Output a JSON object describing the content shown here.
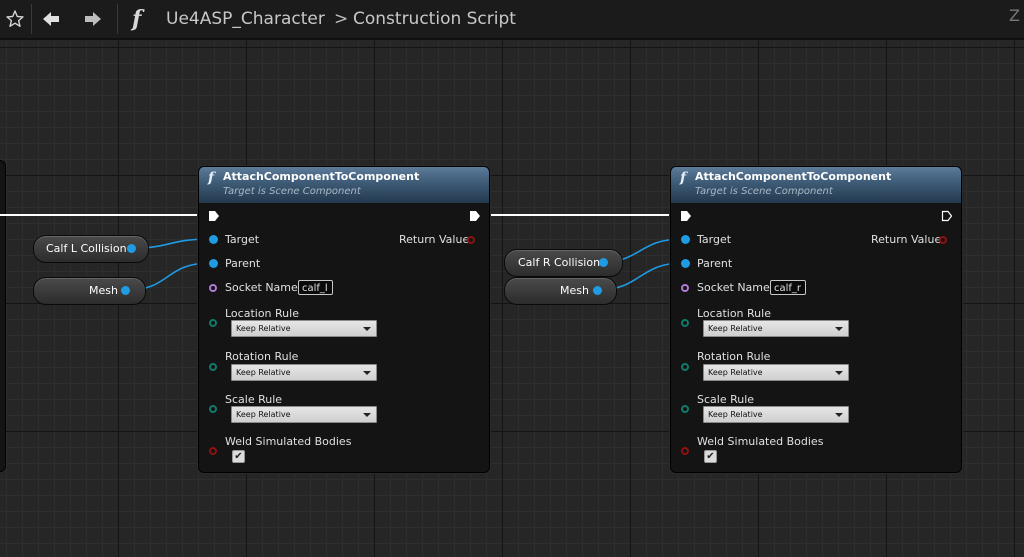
{
  "toolbar": {
    "function_glyph": "f",
    "breadcrumb_parent": "Ue4ASP_Character",
    "breadcrumb_separator": ">",
    "breadcrumb_current": "Construction Script",
    "right_edge_text": "Z"
  },
  "nodes": [
    {
      "title": "AttachComponentToComponent",
      "subtitle": "Target is Scene Component",
      "target_label": "Target",
      "parent_label": "Parent",
      "socket_label": "Socket Name",
      "socket_value": "calf_l",
      "return_label": "Return Value",
      "location_rule_label": "Location Rule",
      "location_rule_value": "Keep Relative",
      "rotation_rule_label": "Rotation Rule",
      "rotation_rule_value": "Keep Relative",
      "scale_rule_label": "Scale Rule",
      "scale_rule_value": "Keep Relative",
      "weld_label": "Weld Simulated Bodies",
      "weld_checked": true
    },
    {
      "title": "AttachComponentToComponent",
      "subtitle": "Target is Scene Component",
      "target_label": "Target",
      "parent_label": "Parent",
      "socket_label": "Socket Name",
      "socket_value": "calf_r",
      "return_label": "Return Value",
      "location_rule_label": "Location Rule",
      "location_rule_value": "Keep Relative",
      "rotation_rule_label": "Rotation Rule",
      "rotation_rule_value": "Keep Relative",
      "scale_rule_label": "Scale Rule",
      "scale_rule_value": "Keep Relative",
      "weld_label": "Weld Simulated Bodies",
      "weld_checked": true
    }
  ],
  "variables": {
    "calf_l_collision": "Calf L Collision",
    "mesh_left": "Mesh",
    "calf_r_collision": "Calf R Collision",
    "mesh_right": "Mesh"
  },
  "colors": {
    "object_pin": "#1e9be3",
    "name_pin": "#b07ad6",
    "enum_pin": "#0f7a6b",
    "bool_pin": "#8f1010",
    "exec_wire": "#ffffff",
    "background": "#262626"
  }
}
